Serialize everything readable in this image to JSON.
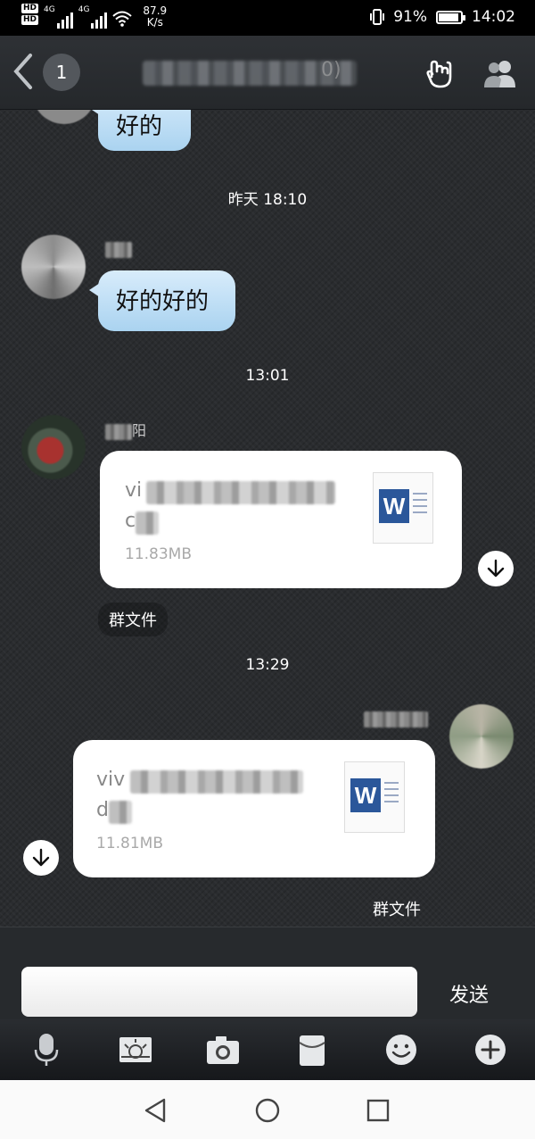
{
  "status_bar": {
    "hd_label": "HD",
    "net_type": "4G",
    "net_speed_value": "87.9",
    "net_speed_unit": "K/s",
    "battery_percent": "91%",
    "battery_level": 0.91,
    "time": "14:02"
  },
  "header": {
    "unread_count": "1",
    "title_suffix": "0)"
  },
  "messages": {
    "time1": "昨天 18:10",
    "time2": "13:01",
    "time3": "13:29",
    "msg0_text": "好的",
    "msg1_text": "好的好的",
    "sender2_name_tail": "阳",
    "file1": {
      "name_start": "vi",
      "name_line2": "c",
      "size": "11.83MB",
      "tag": "群文件"
    },
    "file2": {
      "name_start": "viv",
      "name_line2": "d",
      "size": "11.81MB",
      "tag": "群文件"
    },
    "file_icon_letter": "W"
  },
  "composer": {
    "input_value": "",
    "send_label": "发送"
  },
  "icons": {
    "back": "chevron-left-icon",
    "gesture": "hand-gesture-icon",
    "members": "group-members-icon",
    "mic": "microphone-icon",
    "gallery": "image-icon",
    "camera": "camera-icon",
    "wallet": "red-packet-icon",
    "emoji": "emoji-icon",
    "plus": "plus-icon"
  },
  "colors": {
    "bubble_blue": "#aad3f0",
    "word_blue": "#2b579a",
    "chat_bg": "#2a2c2f"
  }
}
